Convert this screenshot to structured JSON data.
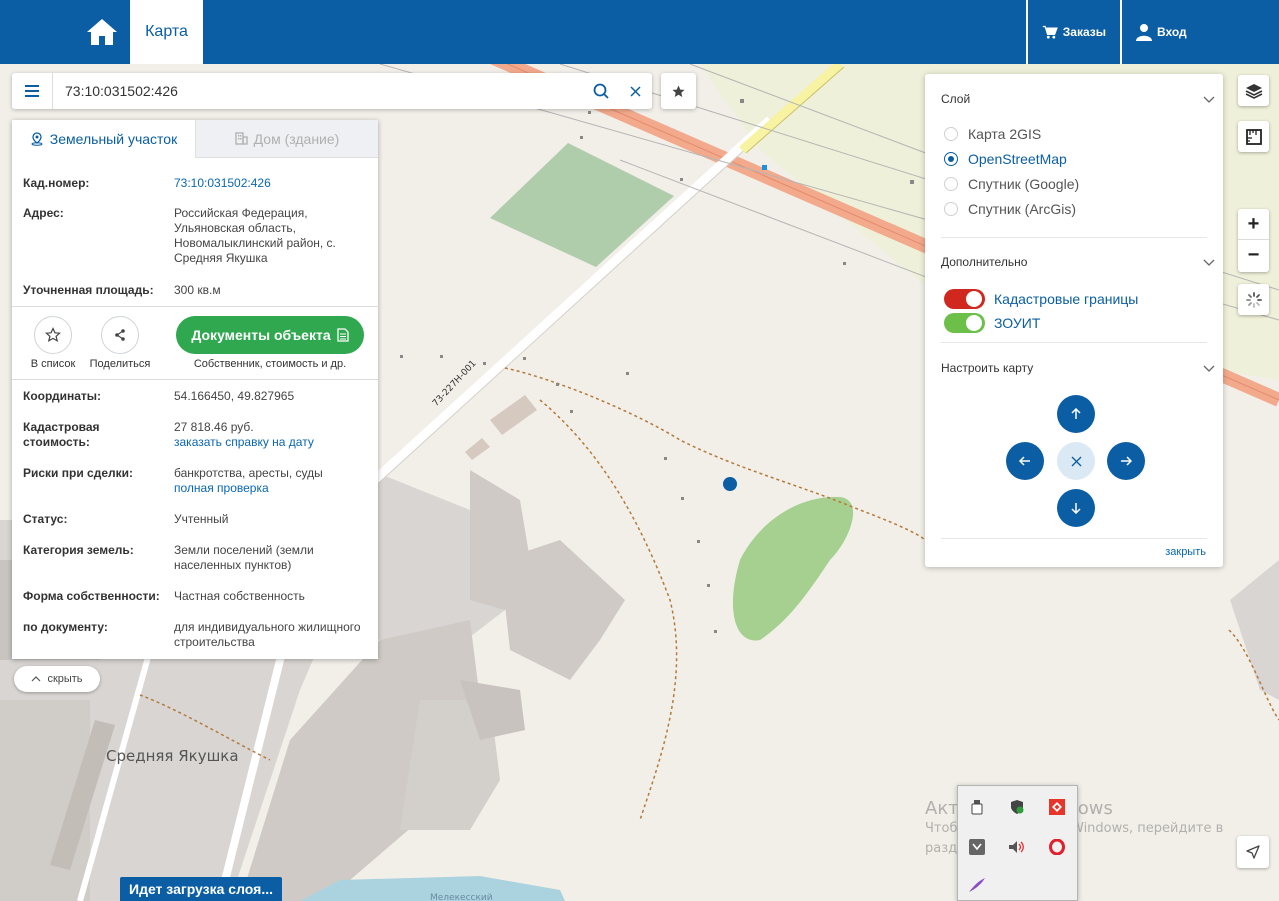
{
  "header": {
    "nav_tab": "Карта",
    "orders_label": "Заказы",
    "login_label": "Вход"
  },
  "search": {
    "value": "73:10:031502:426"
  },
  "parcel_panel": {
    "tabs": [
      {
        "label": "Земельный участок",
        "active": true
      },
      {
        "label": "Дом (здание)",
        "active": false
      }
    ],
    "cad_number": {
      "label": "Кад.номер:",
      "value": "73:10:031502:426"
    },
    "address": {
      "label": "Адрес:",
      "lines": [
        "Российская Федерация,",
        "Ульяновская область,",
        "Новомалыклинский район, с.",
        "Средняя Якушка"
      ]
    },
    "area": {
      "label": "Уточненная площадь:",
      "value": "300 кв.м"
    },
    "actions": {
      "add_to_list": "В список",
      "share": "Поделиться",
      "documents_button": "Документы объекта",
      "documents_sub": "Собственник, стоимость и др."
    },
    "coords": {
      "label": "Координаты:",
      "value": "54.166450, 49.827965"
    },
    "cad_cost": {
      "label_lines": [
        "Кадастровая",
        "стоимость:"
      ],
      "value": "27 818.46 руб.",
      "link": "заказать справку на дату"
    },
    "risks": {
      "label": "Риски при сделки:",
      "value": "банкротства, аресты, суды",
      "link": "полная проверка"
    },
    "status": {
      "label": "Статус:",
      "value": "Учтенный"
    },
    "category": {
      "label": "Категория земель:",
      "lines": [
        "Земли поселений (земли",
        "населенных пунктов)"
      ]
    },
    "ownership": {
      "label": "Форма собственности:",
      "value": "Частная собственность"
    },
    "by_document": {
      "label": "по документу:",
      "lines": [
        "для индивидуального жилищного",
        "строительства"
      ]
    }
  },
  "hide_label": "скрыть",
  "layers": {
    "section_layer": "Слой",
    "base_layers": [
      {
        "label": "Карта 2GIS",
        "selected": false
      },
      {
        "label": "OpenStreetMap",
        "selected": true
      },
      {
        "label": "Спутник (Google)",
        "selected": false
      },
      {
        "label": "Спутник (ArcGis)",
        "selected": false
      }
    ],
    "section_extra": "Дополнительно",
    "overlays": [
      {
        "label": "Кадастровые границы",
        "on": true,
        "color": "#d0281e"
      },
      {
        "label": "ЗОУИТ",
        "on": true,
        "color": "#6cc04a"
      }
    ],
    "section_config": "Настроить карту",
    "close_label": "закрыть"
  },
  "zoom": {
    "plus": "+",
    "minus": "−"
  },
  "map": {
    "place_name": "Средняя Якушка",
    "road_ref": "73-227Н-001",
    "water_label": "Мелекесский"
  },
  "loading_text": "Идет загрузка слоя...",
  "windows_watermark": {
    "title": "Активация Windows",
    "line1": "Чтобы активировать Windows, перейдите в",
    "line2": "раздел \"Параметры\"."
  },
  "colors": {
    "brand": "#0b5ea3",
    "green_button": "#2fa84f",
    "link": "#0b66b0"
  }
}
